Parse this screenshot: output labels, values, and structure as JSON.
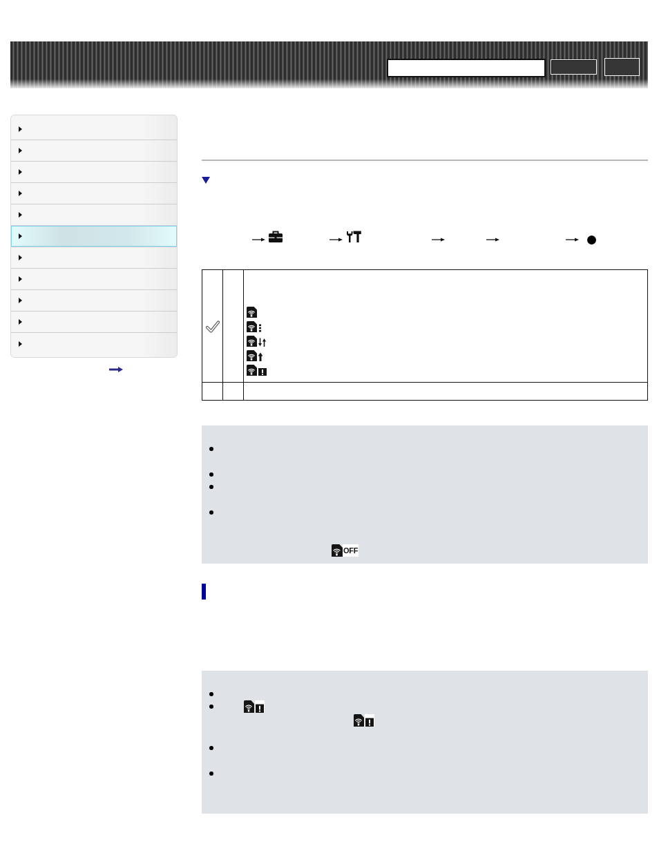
{
  "sidebar": {
    "items": [
      {
        "selected": false
      },
      {
        "selected": false
      },
      {
        "selected": false
      },
      {
        "selected": false
      },
      {
        "selected": false
      },
      {
        "selected": true
      },
      {
        "selected": false
      },
      {
        "selected": false
      },
      {
        "selected": false
      },
      {
        "selected": false
      },
      {
        "selected": false
      }
    ]
  },
  "section": {
    "expanded": true
  },
  "settings_table": {
    "rows": [
      {
        "default": true
      },
      {
        "default": false
      }
    ]
  },
  "note_box": {
    "icon_label": "OFF"
  }
}
